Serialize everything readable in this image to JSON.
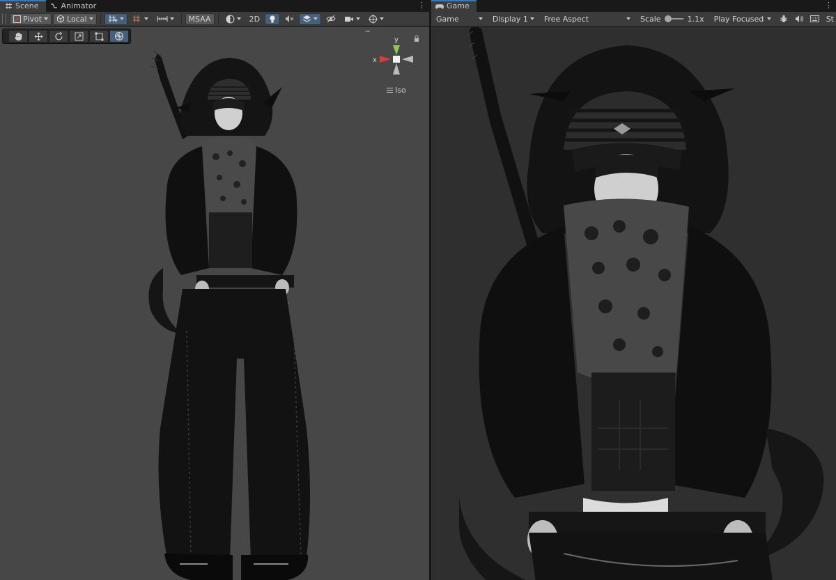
{
  "scene": {
    "tabs": [
      {
        "label": "Scene",
        "icon": "hash-icon",
        "active": true
      },
      {
        "label": "Animator",
        "icon": "animator-icon",
        "active": false
      }
    ],
    "toolbar": {
      "pivot_label": "Pivot",
      "local_label": "Local",
      "msaa_label": "MSAA",
      "twod_label": "2D"
    },
    "gizmo": {
      "y_label": "y",
      "x_label": "x",
      "projection_label": "Iso"
    },
    "overlay_tools": [
      "hand-icon",
      "move-icon",
      "rotate-icon",
      "scale-icon",
      "rect-icon",
      "transform-icon"
    ]
  },
  "game": {
    "tabs": [
      {
        "label": "Game",
        "icon": "gamepad-icon",
        "active": true
      }
    ],
    "toolbar": {
      "display_type": "Game",
      "display_label": "Display 1",
      "aspect_label": "Free Aspect",
      "scale_label": "Scale",
      "scale_value": "1.1x",
      "scale_fraction": 0.15,
      "play_mode_label": "Play Focused",
      "stats_label": "St"
    }
  },
  "colors": {
    "tab_active_accent": "#3a79bb",
    "toolbar_bg": "#3c3c3c",
    "scene_bg": "#474747",
    "game_bg": "#2f2f2f",
    "gizmo_x": "#db3b3b",
    "gizmo_y": "#8bcb48"
  }
}
